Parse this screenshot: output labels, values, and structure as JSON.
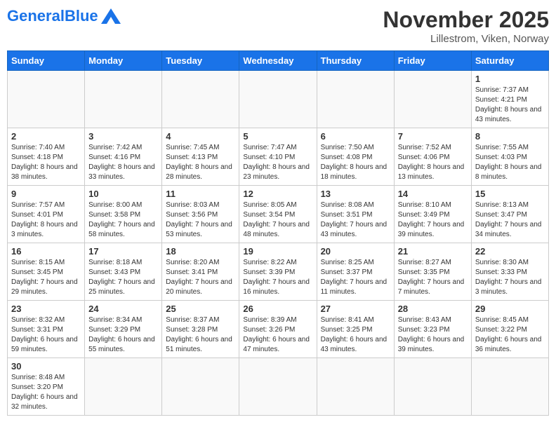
{
  "header": {
    "logo_general": "General",
    "logo_blue": "Blue",
    "title": "November 2025",
    "subtitle": "Lillestrom, Viken, Norway"
  },
  "days_of_week": [
    "Sunday",
    "Monday",
    "Tuesday",
    "Wednesday",
    "Thursday",
    "Friday",
    "Saturday"
  ],
  "weeks": [
    [
      {
        "day": "",
        "info": ""
      },
      {
        "day": "",
        "info": ""
      },
      {
        "day": "",
        "info": ""
      },
      {
        "day": "",
        "info": ""
      },
      {
        "day": "",
        "info": ""
      },
      {
        "day": "",
        "info": ""
      },
      {
        "day": "1",
        "info": "Sunrise: 7:37 AM\nSunset: 4:21 PM\nDaylight: 8 hours\nand 43 minutes."
      }
    ],
    [
      {
        "day": "2",
        "info": "Sunrise: 7:40 AM\nSunset: 4:18 PM\nDaylight: 8 hours\nand 38 minutes."
      },
      {
        "day": "3",
        "info": "Sunrise: 7:42 AM\nSunset: 4:16 PM\nDaylight: 8 hours\nand 33 minutes."
      },
      {
        "day": "4",
        "info": "Sunrise: 7:45 AM\nSunset: 4:13 PM\nDaylight: 8 hours\nand 28 minutes."
      },
      {
        "day": "5",
        "info": "Sunrise: 7:47 AM\nSunset: 4:10 PM\nDaylight: 8 hours\nand 23 minutes."
      },
      {
        "day": "6",
        "info": "Sunrise: 7:50 AM\nSunset: 4:08 PM\nDaylight: 8 hours\nand 18 minutes."
      },
      {
        "day": "7",
        "info": "Sunrise: 7:52 AM\nSunset: 4:06 PM\nDaylight: 8 hours\nand 13 minutes."
      },
      {
        "day": "8",
        "info": "Sunrise: 7:55 AM\nSunset: 4:03 PM\nDaylight: 8 hours\nand 8 minutes."
      }
    ],
    [
      {
        "day": "9",
        "info": "Sunrise: 7:57 AM\nSunset: 4:01 PM\nDaylight: 8 hours\nand 3 minutes."
      },
      {
        "day": "10",
        "info": "Sunrise: 8:00 AM\nSunset: 3:58 PM\nDaylight: 7 hours\nand 58 minutes."
      },
      {
        "day": "11",
        "info": "Sunrise: 8:03 AM\nSunset: 3:56 PM\nDaylight: 7 hours\nand 53 minutes."
      },
      {
        "day": "12",
        "info": "Sunrise: 8:05 AM\nSunset: 3:54 PM\nDaylight: 7 hours\nand 48 minutes."
      },
      {
        "day": "13",
        "info": "Sunrise: 8:08 AM\nSunset: 3:51 PM\nDaylight: 7 hours\nand 43 minutes."
      },
      {
        "day": "14",
        "info": "Sunrise: 8:10 AM\nSunset: 3:49 PM\nDaylight: 7 hours\nand 39 minutes."
      },
      {
        "day": "15",
        "info": "Sunrise: 8:13 AM\nSunset: 3:47 PM\nDaylight: 7 hours\nand 34 minutes."
      }
    ],
    [
      {
        "day": "16",
        "info": "Sunrise: 8:15 AM\nSunset: 3:45 PM\nDaylight: 7 hours\nand 29 minutes."
      },
      {
        "day": "17",
        "info": "Sunrise: 8:18 AM\nSunset: 3:43 PM\nDaylight: 7 hours\nand 25 minutes."
      },
      {
        "day": "18",
        "info": "Sunrise: 8:20 AM\nSunset: 3:41 PM\nDaylight: 7 hours\nand 20 minutes."
      },
      {
        "day": "19",
        "info": "Sunrise: 8:22 AM\nSunset: 3:39 PM\nDaylight: 7 hours\nand 16 minutes."
      },
      {
        "day": "20",
        "info": "Sunrise: 8:25 AM\nSunset: 3:37 PM\nDaylight: 7 hours\nand 11 minutes."
      },
      {
        "day": "21",
        "info": "Sunrise: 8:27 AM\nSunset: 3:35 PM\nDaylight: 7 hours\nand 7 minutes."
      },
      {
        "day": "22",
        "info": "Sunrise: 8:30 AM\nSunset: 3:33 PM\nDaylight: 7 hours\nand 3 minutes."
      }
    ],
    [
      {
        "day": "23",
        "info": "Sunrise: 8:32 AM\nSunset: 3:31 PM\nDaylight: 6 hours\nand 59 minutes."
      },
      {
        "day": "24",
        "info": "Sunrise: 8:34 AM\nSunset: 3:29 PM\nDaylight: 6 hours\nand 55 minutes."
      },
      {
        "day": "25",
        "info": "Sunrise: 8:37 AM\nSunset: 3:28 PM\nDaylight: 6 hours\nand 51 minutes."
      },
      {
        "day": "26",
        "info": "Sunrise: 8:39 AM\nSunset: 3:26 PM\nDaylight: 6 hours\nand 47 minutes."
      },
      {
        "day": "27",
        "info": "Sunrise: 8:41 AM\nSunset: 3:25 PM\nDaylight: 6 hours\nand 43 minutes."
      },
      {
        "day": "28",
        "info": "Sunrise: 8:43 AM\nSunset: 3:23 PM\nDaylight: 6 hours\nand 39 minutes."
      },
      {
        "day": "29",
        "info": "Sunrise: 8:45 AM\nSunset: 3:22 PM\nDaylight: 6 hours\nand 36 minutes."
      }
    ],
    [
      {
        "day": "30",
        "info": "Sunrise: 8:48 AM\nSunset: 3:20 PM\nDaylight: 6 hours\nand 32 minutes."
      },
      {
        "day": "",
        "info": ""
      },
      {
        "day": "",
        "info": ""
      },
      {
        "day": "",
        "info": ""
      },
      {
        "day": "",
        "info": ""
      },
      {
        "day": "",
        "info": ""
      },
      {
        "day": "",
        "info": ""
      }
    ]
  ]
}
